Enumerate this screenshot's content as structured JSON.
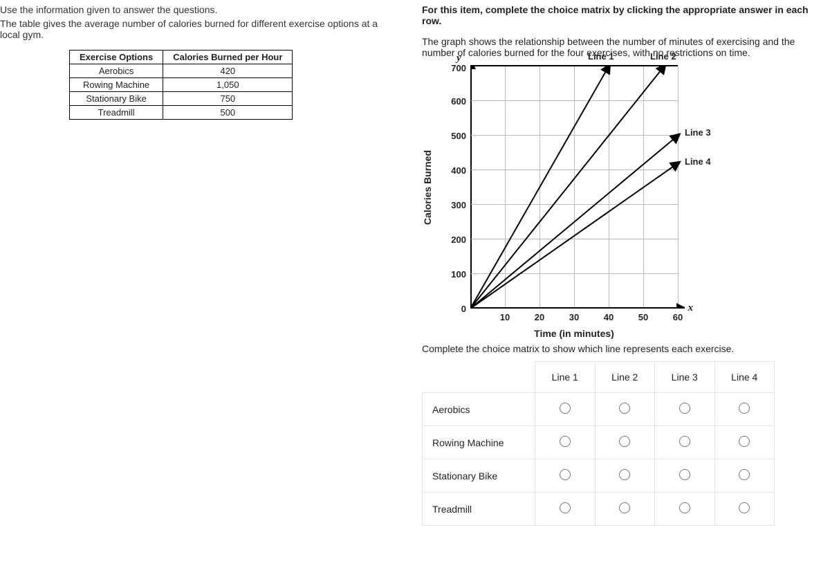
{
  "left": {
    "intro": "Use the information given to answer the questions.",
    "sub": "The table gives the average number of calories burned for different exercise options at a local gym.",
    "table": {
      "headers": [
        "Exercise Options",
        "Calories Burned per Hour"
      ],
      "rows": [
        [
          "Aerobics",
          "420"
        ],
        [
          "Rowing Machine",
          "1,050"
        ],
        [
          "Stationary Bike",
          "750"
        ],
        [
          "Treadmill",
          "500"
        ]
      ]
    }
  },
  "right": {
    "instruction_bold": "For this item, complete the choice matrix by clicking the appropriate answer in each row.",
    "graph_intro": "The graph shows the relationship between the number of minutes of exercising and the number of calories burned for the four exercises, with no restrictions on time.",
    "matrix_intro": "Complete the choice matrix to show which line represents each exercise.",
    "matrix_headers": [
      "",
      "Line 1",
      "Line 2",
      "Line 3",
      "Line 4"
    ],
    "matrix_rows": [
      "Aerobics",
      "Rowing Machine",
      "Stationary Bike",
      "Treadmill"
    ]
  },
  "chart_data": {
    "type": "line",
    "title": "",
    "xlabel": "Time (in minutes)",
    "ylabel": "Calories Burned",
    "y_letter": "y",
    "x_letter": "x",
    "xlim": [
      0,
      60
    ],
    "ylim": [
      0,
      700
    ],
    "xticks": [
      0,
      10,
      20,
      30,
      40,
      50,
      60
    ],
    "yticks": [
      0,
      100,
      200,
      300,
      400,
      500,
      600,
      700
    ],
    "series": [
      {
        "name": "Line 1",
        "slope_per_min": 17.5,
        "points": {
          "x": [
            0,
            40
          ],
          "y": [
            0,
            700
          ]
        }
      },
      {
        "name": "Line 2",
        "slope_per_min": 12.5,
        "points": {
          "x": [
            0,
            56
          ],
          "y": [
            0,
            700
          ]
        }
      },
      {
        "name": "Line 3",
        "slope_per_min": 8.33,
        "points": {
          "x": [
            0,
            60
          ],
          "y": [
            0,
            500
          ]
        }
      },
      {
        "name": "Line 4",
        "slope_per_min": 7.0,
        "points": {
          "x": [
            0,
            60
          ],
          "y": [
            0,
            420
          ]
        }
      }
    ],
    "line_labels": {
      "Line 1": "Line 1",
      "Line 2": "Line 2",
      "Line 3": "Line 3",
      "Line 4": "Line 4"
    }
  }
}
